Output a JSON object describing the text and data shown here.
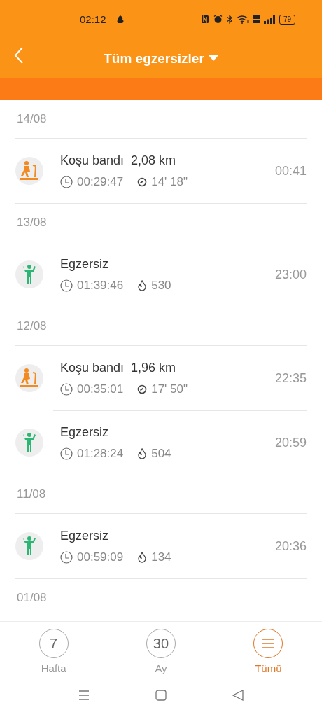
{
  "status_bar": {
    "time": "02:12",
    "battery": "79"
  },
  "header": {
    "title": "Tüm egzersizler"
  },
  "groups": [
    {
      "date": "14/08",
      "entries": [
        {
          "kind": "treadmill",
          "title": "Koşu bandı  2,08 km",
          "duration": "00:29:47",
          "stat": "14' 18\"",
          "time": "00:41"
        }
      ]
    },
    {
      "date": "13/08",
      "entries": [
        {
          "kind": "workout",
          "title": "Egzersiz",
          "duration": "01:39:46",
          "stat": "530",
          "time": "23:00"
        }
      ]
    },
    {
      "date": "12/08",
      "entries": [
        {
          "kind": "treadmill",
          "title": "Koşu bandı  1,96 km",
          "duration": "00:35:01",
          "stat": "17' 50\"",
          "time": "22:35"
        },
        {
          "kind": "workout",
          "title": "Egzersiz",
          "duration": "01:28:24",
          "stat": "504",
          "time": "20:59"
        }
      ]
    },
    {
      "date": "11/08",
      "entries": [
        {
          "kind": "workout",
          "title": "Egzersiz",
          "duration": "00:59:09",
          "stat": "134",
          "time": "20:36"
        }
      ]
    },
    {
      "date": "01/08"
    }
  ],
  "tabs": [
    {
      "kind": "number",
      "icon_text": "7",
      "label": "Hafta",
      "selected": false
    },
    {
      "kind": "number",
      "icon_text": "30",
      "label": "Ay",
      "selected": false
    },
    {
      "kind": "menu",
      "label": "Tümü",
      "selected": true
    }
  ]
}
